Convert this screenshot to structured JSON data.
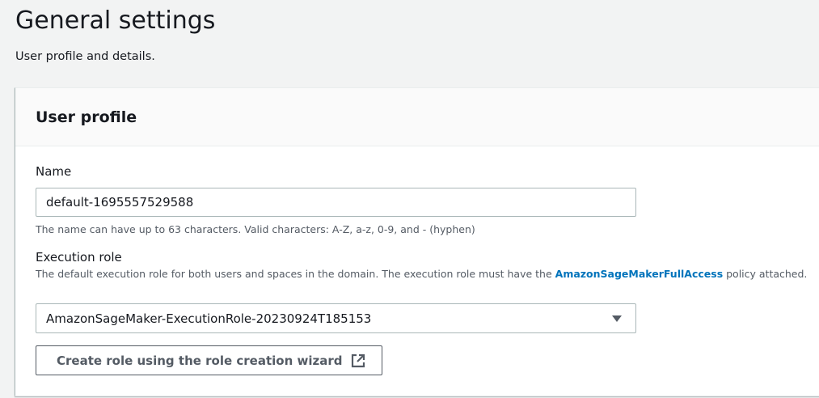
{
  "page": {
    "title": "General settings",
    "subtitle": "User profile and details."
  },
  "panel": {
    "title": "User profile",
    "name": {
      "label": "Name",
      "value": "default-1695557529588",
      "hint": "The name can have up to 63 characters. Valid characters: A-Z, a-z, 0-9, and - (hyphen)"
    },
    "execution_role": {
      "label": "Execution role",
      "description_before": "The default execution role for both users and spaces in the domain. The execution role must have the ",
      "link_text": "AmazonSageMakerFullAccess",
      "description_after": " policy attached.",
      "selected_value": "AmazonSageMaker-ExecutionRole-20230924T185153",
      "dropdown_icon": "caret-down-icon"
    },
    "create_role_button": {
      "label": "Create role using the role creation wizard",
      "icon": "external-link-icon"
    }
  },
  "colors": {
    "page_background": "#f2f3f3",
    "panel_background": "#ffffff",
    "text_primary": "#16191f",
    "text_secondary": "#545b64",
    "link": "#0073bb",
    "border": "#aab7b8"
  }
}
